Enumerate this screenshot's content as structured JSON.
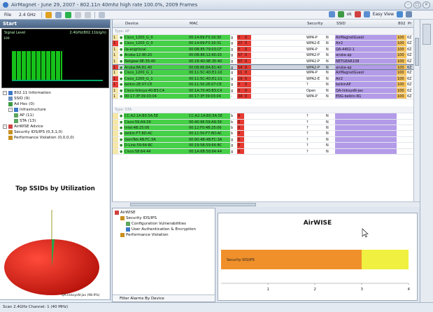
{
  "window": {
    "title": "AirMagnet - June 29, 2007 - 802.11n 40mhz high rate 100.0%, 2009 Frames"
  },
  "toolbar": {
    "file": "File",
    "band": "2.4 GHz",
    "easy_view": "Easy View",
    "ok": "ok"
  },
  "left": {
    "start_label": "Start",
    "signal_label": "Signal Level",
    "signal_freq": "2.4GHz(802.11b/g/n)",
    "signal_level_value": "100",
    "signal_fill": 0.45,
    "tree": [
      {
        "label": "802.11 Information",
        "indent": 0,
        "exp": "-"
      },
      {
        "label": "SSID (9)",
        "indent": 1,
        "exp": ""
      },
      {
        "label": "Ad Hoc (0)",
        "indent": 1,
        "exp": ""
      },
      {
        "label": "Infrastructure",
        "indent": 1,
        "exp": "-"
      },
      {
        "label": "AP (11)",
        "indent": 2,
        "exp": ""
      },
      {
        "label": "STA (13)",
        "indent": 2,
        "exp": ""
      },
      {
        "label": "AirWISE Advice",
        "indent": 0,
        "exp": "-"
      },
      {
        "label": "Security IDS/IPS (0,3,1,0)",
        "indent": 1,
        "exp": ""
      },
      {
        "label": "Performance Violation (0,0,0,0)",
        "indent": 1,
        "exp": ""
      }
    ],
    "ssid_title": "Top SSIDs by Utilization",
    "pie_label": "QA-linksysN-jav (98.9%)"
  },
  "grid": {
    "headers": {
      "device": "Device",
      "mac": "MAC",
      "security": "Security",
      "ssid": "SSID",
      "col_b": "802",
      "col_c": "Pr"
    },
    "section_ap": "Type: AP",
    "section_sta": "Type: STA",
    "ap_rows": [
      {
        "n": "1",
        "name": "Cisco_1200_G_0",
        "mac": "00:14:69:F3:16:30",
        "g": "g",
        "v1": "0",
        "v2": "0",
        "sec": "WPA-P",
        "flag": "N",
        "ssid": "AirMagnetGuest",
        "u": "100",
        "col": "6Z",
        "sel": false,
        "ab": false
      },
      {
        "n": "1",
        "name": "Cisco_1200_G_0",
        "mac": "00:14:69:F3:16:31",
        "g": "g",
        "v1": "27",
        "v2": "0",
        "sec": "WPA2-E",
        "flag": "N",
        "ssid": "Air2",
        "u": "100",
        "col": "6Z",
        "sel": false,
        "ab": true
      },
      {
        "n": "1",
        "name": "ila-engrlocal",
        "mac": "00:0B:85:79:03:CF",
        "g": "g",
        "v1": "0",
        "v2": "0",
        "sec": "WPA-P",
        "flag": "N",
        "ssid": "QA-4402-1",
        "u": "100",
        "col": "6Z",
        "sel": false,
        "ab": false
      },
      {
        "n": "1",
        "name": "Aruba-12:90:20",
        "mac": "00:0B:86:12:90:20",
        "g": "g",
        "v1": "57",
        "v2": "0",
        "sec": "WPA2-P",
        "flag": "N",
        "ssid": "aruba-ap",
        "u": "100",
        "col": "6Z",
        "sel": false,
        "ab": false
      },
      {
        "n": "1",
        "name": "Netgear-9E:35:40",
        "mac": "00:18:4D:9E:35:40",
        "g": "g",
        "v1": "57",
        "v2": "0",
        "sec": "WPA2-P",
        "flag": "N",
        "ssid": "NETGEAR108",
        "u": "100",
        "col": "6Z",
        "sel": false,
        "ab": false
      },
      {
        "n": "1",
        "name": "Aruba:8A:81:40",
        "mac": "00:08:86:8A:81:40",
        "g": "g",
        "v1": "54",
        "v2": "0",
        "sec": "WPA2-P",
        "flag": "N",
        "ssid": "aruba-ap",
        "u": "100",
        "col": "6Z",
        "sel": true,
        "ab": true
      },
      {
        "n": "1",
        "name": "Cisco_1200_G_1",
        "mac": "00:11:5C:4D:E1:10",
        "g": "g",
        "v1": "11",
        "v2": "0",
        "sec": "WPA-P",
        "flag": "N",
        "ssid": "AirMagnetGuest",
        "u": "100",
        "col": "6Z",
        "sel": false,
        "ab": false
      },
      {
        "n": "1",
        "name": "Cisco_1200_G_1",
        "mac": "00:11:5C:4D:E1:11",
        "g": "g",
        "v1": "19",
        "v2": "0",
        "sec": "WPA2-E",
        "flag": "N",
        "ssid": "Air2",
        "u": "100",
        "col": "6Z",
        "sel": false,
        "ab": true
      },
      {
        "n": "1",
        "name": "belkin:2E:07:CE",
        "mac": "00:11:50:2E:07:CE",
        "g": "g",
        "v1": "0",
        "v2": "0",
        "sec": "?",
        "flag": "N",
        "ssid": "belkinAP",
        "u": "100",
        "col": "6Z",
        "sel": false,
        "ab": true
      },
      {
        "n": "1",
        "name": "Cisco-linksys:40:B3:C4",
        "mac": "00:1A:70:40:B3:C4",
        "g": "g",
        "v1": "0",
        "v2": "0",
        "sec": "Open",
        "flag": "N",
        "ssid": "QA-linksysN-jav",
        "u": "100",
        "col": "6Z",
        "sel": false,
        "ab": false
      },
      {
        "n": "1",
        "name": "00:17:3F:39:03:04",
        "mac": "00:17:3F:39:03:04",
        "g": "-",
        "v1": "34",
        "v2": "0",
        "sec": "WPA-P",
        "flag": "N",
        "ssid": "ENG-belkin-N1",
        "u": "100",
        "col": "6Z",
        "sel": false,
        "ab": false
      }
    ],
    "sta_rows": [
      {
        "name": "CC:A2:1A:B0:5A:5E",
        "mac": "CC:A2:1A:B0:5A:5E",
        "g": "b",
        "v1": "0",
        "sec": "?",
        "flag": "N"
      },
      {
        "name": "Cisco:59:A9:39",
        "mac": "00:40:96:59:A9:39",
        "g": "b",
        "v1": "0",
        "sec": "?",
        "flag": "N"
      },
      {
        "name": "Intel:4B:25:06",
        "mac": "00:12:F0:4B:25:06",
        "g": "b",
        "v1": "0",
        "sec": "?",
        "flag": "N"
      },
      {
        "name": "belkin:F7:8D:AC",
        "mac": "00:11:50:F7:8D:AC",
        "g": "b",
        "v1": "0",
        "sec": "?",
        "flag": "N"
      },
      {
        "name": "GemTek:4B:FC:3A",
        "mac": "00:90:4B:4B:FC:3A",
        "g": "g",
        "v1": "0",
        "sec": "?",
        "flag": "N"
      },
      {
        "name": "D-Link:59:64:BC",
        "mac": "00:19:5B:59:64:BC",
        "g": "g",
        "v1": "0",
        "sec": "?",
        "flag": "N"
      },
      {
        "name": "Cisco:58:64:44",
        "mac": "00:1A:6B:58:64:44",
        "g": "g",
        "v1": "0",
        "sec": "?",
        "flag": "N"
      }
    ]
  },
  "alarm_tree": {
    "items": [
      {
        "label": "AirWISE",
        "indent": 0
      },
      {
        "label": "Security IDS/IPS",
        "indent": 1
      },
      {
        "label": "Configuration Vulnerabilities",
        "indent": 2
      },
      {
        "label": "User Authentication & Encryption",
        "indent": 2
      },
      {
        "label": "Performance Violation",
        "indent": 1
      }
    ],
    "filter": "Filter Alarms By Device"
  },
  "airwise": {
    "title": "AirWISE",
    "bar_label": "Security IDS/IPS",
    "orange_value": 3,
    "yellow_value": 4,
    "ticks": [
      "1",
      "2",
      "3",
      "4"
    ],
    "orange": "#f0902a",
    "yellow": "#f0f040"
  },
  "status": {
    "text": "Scan 2.4GHz Channel: 1 (40 MHz)"
  },
  "colors": {
    "ap_green": "#46d048",
    "sec_red": "#e63a32",
    "ssid_purple": "#b39be8",
    "util_orange": "#f6c35a"
  }
}
